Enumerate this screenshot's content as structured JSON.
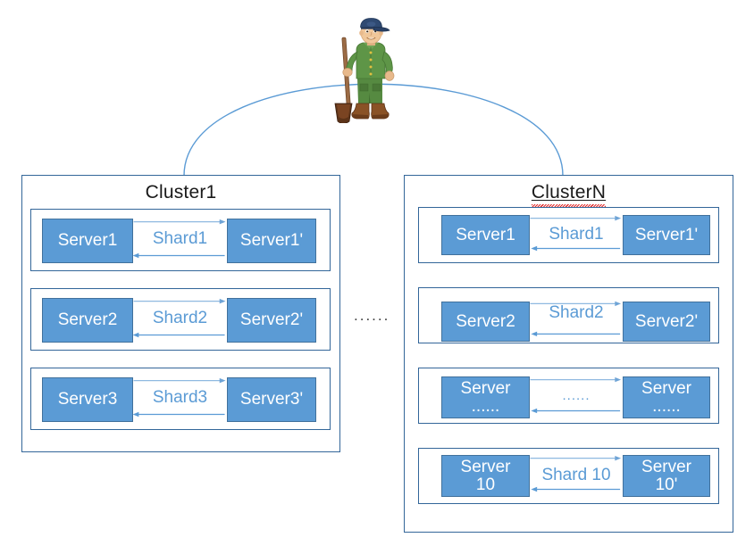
{
  "diagram": {
    "title": "Sharded cluster replication diagram",
    "colors": {
      "server_fill": "#5B9BD5",
      "server_border": "#41719C",
      "box_border": "#336699",
      "arrow_forward": "#8FB9E0",
      "arrow_back": "#5B9BD5",
      "label_text": "#5B9BD5",
      "spellcheck_underline": "#E01B1B"
    },
    "actor": {
      "icon": "worker-with-shovel-icon",
      "description": "Cartoon worker in green overalls and blue cap holding a shovel"
    },
    "connector": {
      "icon": "arc-connector-icon",
      "description": "Blue arc linking Cluster1 and ClusterN"
    },
    "between_clusters_ellipsis": "......"
  },
  "clusters": [
    {
      "name": "Cluster1",
      "spellchecked": false,
      "underlined": false,
      "rows": [
        {
          "left_server": {
            "line1": "Server1",
            "line2": ""
          },
          "shard_label": "Shard1",
          "right_server": {
            "line1": "Server1'",
            "line2": ""
          }
        },
        {
          "left_server": {
            "line1": "Server2",
            "line2": ""
          },
          "shard_label": "Shard2",
          "right_server": {
            "line1": "Server2'",
            "line2": ""
          }
        },
        {
          "left_server": {
            "line1": "Server3",
            "line2": ""
          },
          "shard_label": "Shard3",
          "right_server": {
            "line1": "Server3'",
            "line2": ""
          }
        }
      ]
    },
    {
      "name": "ClusterN",
      "spellchecked": true,
      "underlined": true,
      "rows": [
        {
          "left_server": {
            "line1": "Server1",
            "line2": ""
          },
          "shard_label": "Shard1",
          "right_server": {
            "line1": "Server1'",
            "line2": ""
          }
        },
        {
          "left_server": {
            "line1": "Server2",
            "line2": ""
          },
          "shard_label": "Shard2",
          "right_server": {
            "line1": "Server2'",
            "line2": ""
          }
        },
        {
          "left_server": {
            "line1": "Server",
            "line2": "......"
          },
          "shard_label": "......",
          "right_server": {
            "line1": "Server",
            "line2": "......"
          }
        },
        {
          "left_server": {
            "line1": "Server",
            "line2": "10"
          },
          "shard_label": "Shard 10",
          "right_server": {
            "line1": "Server",
            "line2": "10'"
          }
        }
      ]
    }
  ]
}
